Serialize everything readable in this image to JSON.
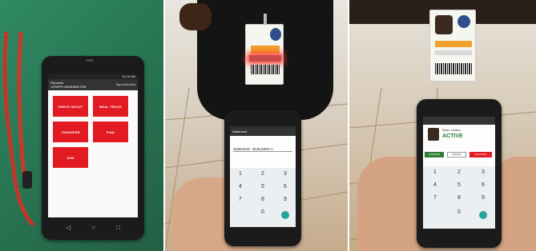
{
  "panel1": {
    "app_title": "Flipcards",
    "app_subtitle": "JOSEPH WASHINGTON",
    "header_right": "Synchronized",
    "status_time": "10:16 AM",
    "tiles": [
      {
        "label": "CHECK IN/OUT",
        "icon": "check-icon"
      },
      {
        "label": "MEAL TRACK",
        "icon": "meal-icon"
      },
      {
        "label": "TRANSFER",
        "icon": "transfer-icon"
      },
      {
        "label": "FIND",
        "icon": "find-icon"
      },
      {
        "label": "ADD",
        "icon": "add-icon"
      }
    ]
  },
  "panel2": {
    "screen_header": "Statement",
    "input_label": "Statement - BUILDING A",
    "keypad": [
      "1",
      "2",
      "3",
      "4",
      "5",
      "6",
      "7",
      "8",
      "9",
      "0"
    ]
  },
  "panel3": {
    "person_name": "Brian Jordan",
    "status": "ACTIVE",
    "buttons": [
      "CONFIRM",
      "CANCEL",
      "DECLINED"
    ],
    "keypad": [
      "1",
      "2",
      "3",
      "4",
      "5",
      "6",
      "7",
      "8",
      "9",
      "0"
    ]
  },
  "colors": {
    "accent": "#e21b23",
    "status_active": "#2e7d32"
  }
}
